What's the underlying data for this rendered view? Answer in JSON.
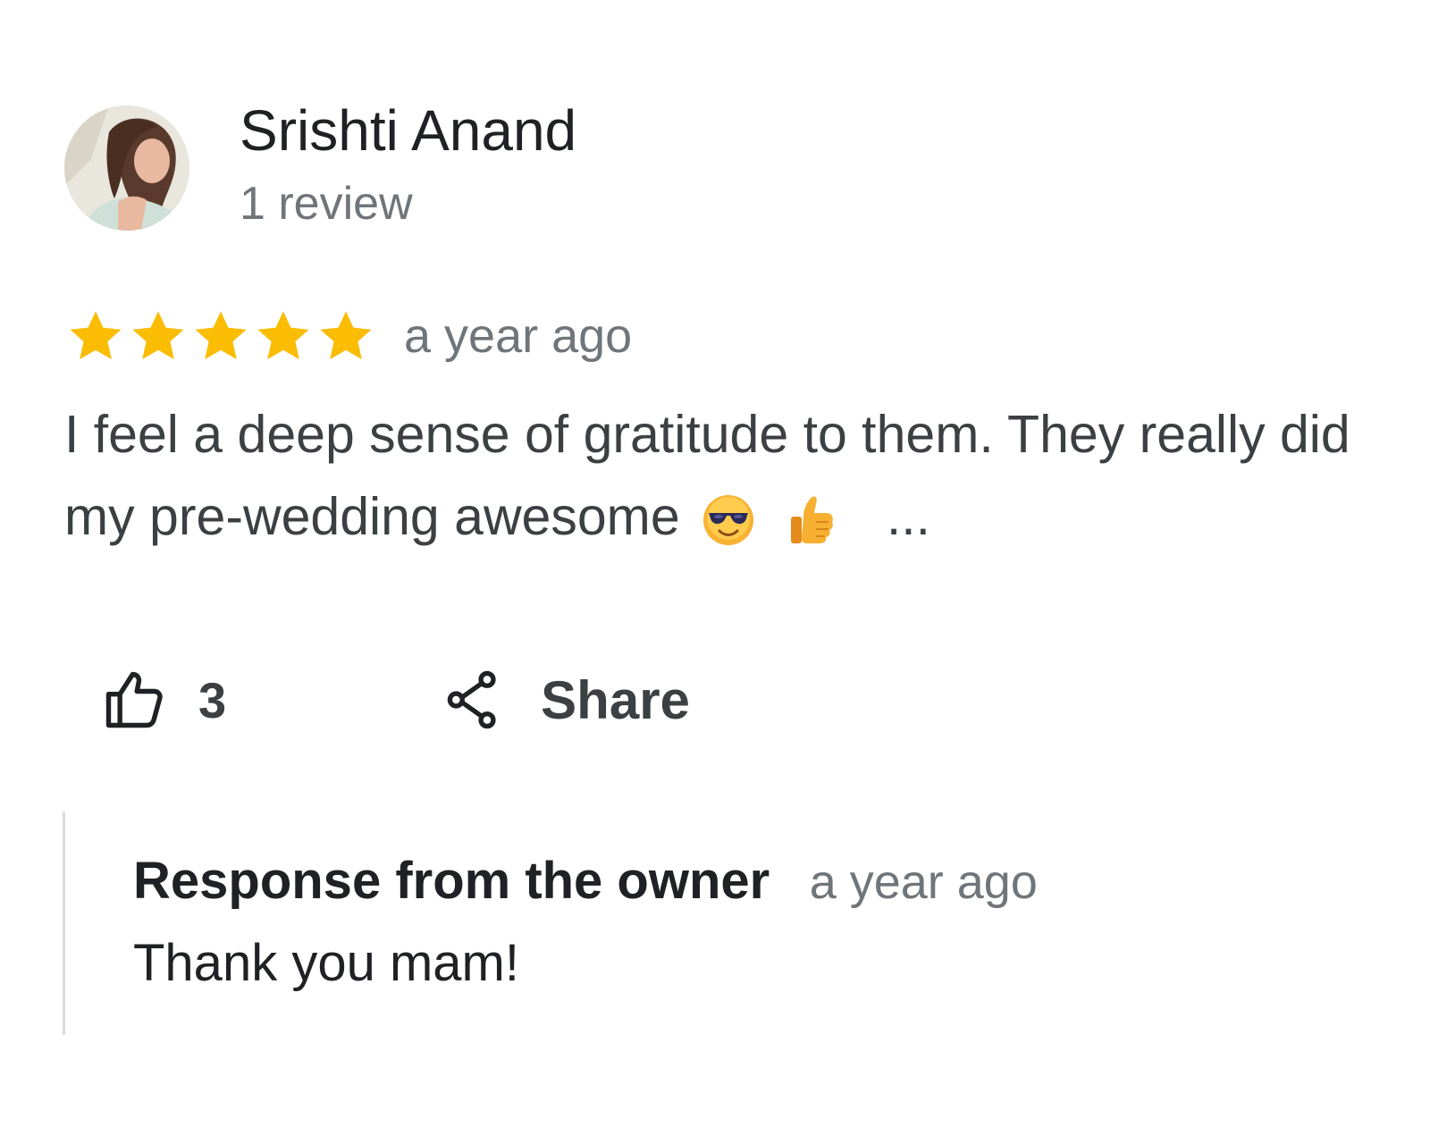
{
  "reviewer": {
    "name": "Srishti Anand",
    "meta": "1 review",
    "avatar_icon": "profile-photo"
  },
  "rating": {
    "stars": 5,
    "max": 5,
    "star_color": "#fbbc04",
    "time": "a year ago"
  },
  "review": {
    "text": "I feel a deep sense of gratitude to them. They really did my pre-wedding awesome",
    "emojis": [
      "sunglasses-face-emoji",
      "thumbs-up-emoji"
    ],
    "more_label": "..."
  },
  "actions": {
    "like_icon": "thumbs-up-icon",
    "like_count": "3",
    "share_icon": "share-icon",
    "share_label": "Share"
  },
  "owner_response": {
    "title": "Response from the owner",
    "time": "a year ago",
    "text": "Thank you mam!"
  },
  "colors": {
    "text_primary": "#202124",
    "text_secondary": "#70757a",
    "divider": "#dadce0"
  }
}
